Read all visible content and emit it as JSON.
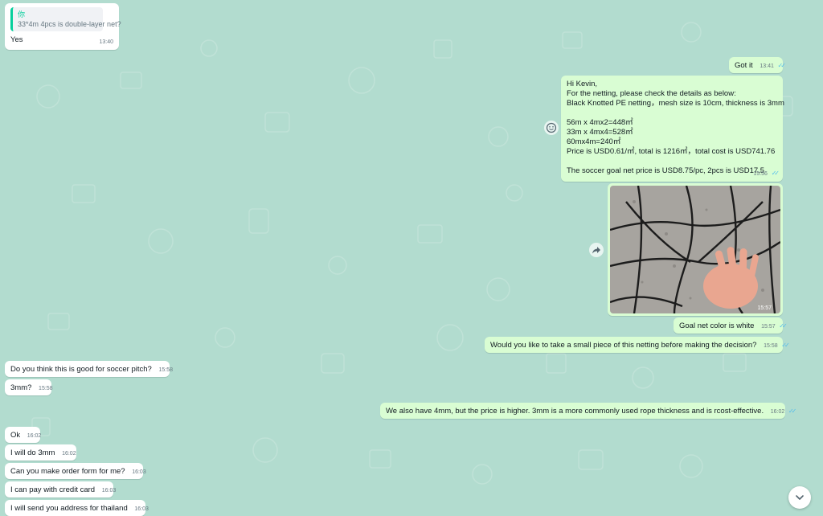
{
  "messages": {
    "m1": {
      "quote_author": "你",
      "quote_text": "33*4m 4pcs is double-layer net?",
      "text": "Yes",
      "time": "13:40"
    },
    "m2": {
      "text": "Got it",
      "time": "13:41"
    },
    "m3": {
      "lines": [
        "Hi Kevin,",
        "For the netting, please check the details as below:",
        "Black Knotted PE netting，mesh size is 10cm, thickness is 3mm",
        "",
        "56m x 4mx2=448㎡",
        "33m x 4mx4=528㎡",
        "60mx4m=240㎡",
        "Price is USD0.61/㎡, total is 1216㎡，total cost is USD741.76",
        "",
        "The soccer goal net price is USD8.75/pc, 2pcs is USD17.5"
      ],
      "time": "15:56"
    },
    "m4": {
      "time": "15:57"
    },
    "m5": {
      "text": "Goal net color is white",
      "time": "15:57"
    },
    "m6": {
      "text": "Would you like to take a small piece of this netting before making the decision?",
      "time": "15:58"
    },
    "m7": {
      "text": "Do you think this is good for soccer pitch?",
      "time": "15:58"
    },
    "m8": {
      "text": "3mm?",
      "time": "15:58"
    },
    "m9": {
      "text": "We also have 4mm, but the price is higher. 3mm is a more commonly used rope thickness and is rcost-effective.",
      "time": "16:02"
    },
    "m10": {
      "text": "Ok",
      "time": "16:02"
    },
    "m11": {
      "text": "I will do 3mm",
      "time": "16:02"
    },
    "m12": {
      "text": "Can you make order form for me?",
      "time": "16:03"
    },
    "m13": {
      "text": "I can pay with credit card",
      "time": "16:03"
    },
    "m14": {
      "text": "I will send you address for thailand",
      "time": "16:03"
    }
  },
  "icons": {
    "read_receipt": "double-check-icon",
    "react": "emoji-icon",
    "forward": "forward-icon",
    "scroll_down": "chevron-down-icon"
  },
  "colors": {
    "wallpaper": "#b2dccf",
    "incoming": "#ffffff",
    "outgoing": "#d9fdd3",
    "read_tick": "#53bdeb",
    "quote_accent": "#06cf9c"
  }
}
